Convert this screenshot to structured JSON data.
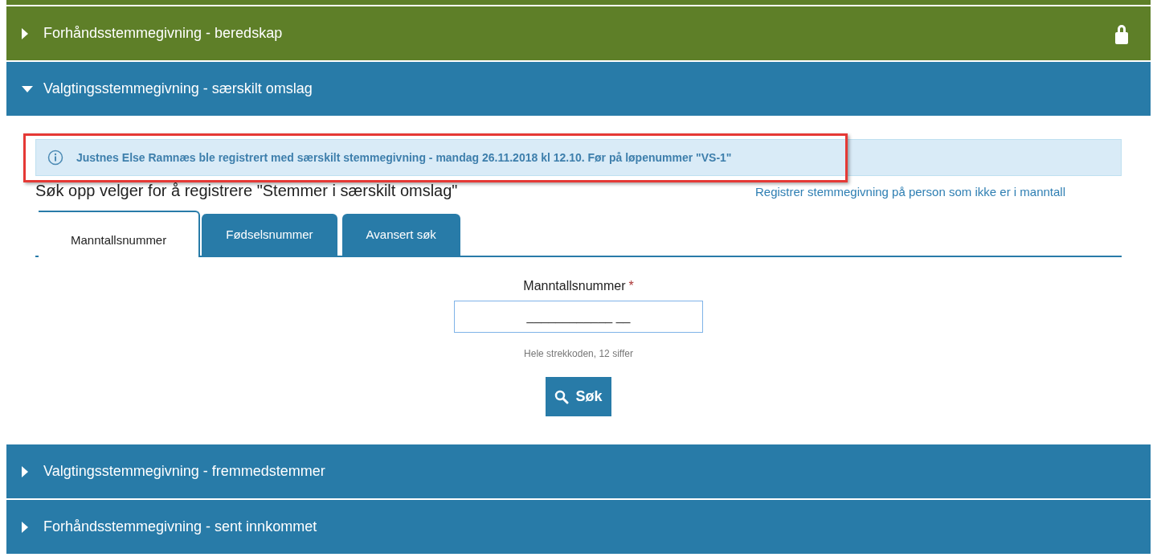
{
  "sections_above": [
    {
      "color": "#5e7f28"
    }
  ],
  "sections": [
    {
      "title": "Forhåndsstemmegivning - beredskap",
      "color": "#5e7f28",
      "expanded": false,
      "locked": true
    },
    {
      "title": "Valgtingsstemmegivning - særskilt omslag",
      "color": "#287ba8",
      "expanded": true,
      "locked": false
    }
  ],
  "panel": {
    "alert": {
      "text": "Justnes Else Ramnæs ble registrert med særskilt stemmegivning - mandag 26.11.2018 kl 12.10. Før på løpenummer \"VS-1\"",
      "highlighted": true
    },
    "heading": "Søk opp velger for å registrere \"Stemmer i særskilt omslag\"",
    "link": "Registrer stemmegivning på person som ikke er i manntall",
    "tabs": [
      {
        "label": "Manntallsnummer",
        "selected": true
      },
      {
        "label": "Fødselsnummer",
        "selected": false
      },
      {
        "label": "Avansert søk",
        "selected": false
      }
    ],
    "field": {
      "label": "Manntallsnummer",
      "required_mark": "*",
      "placeholder": "____________ __",
      "help": "Hele strekkoden, 12 siffer"
    },
    "button": "Søk"
  },
  "sections_below": [
    {
      "title": "Valgtingsstemmegivning - fremmedstemmer",
      "color": "#287ba8",
      "expanded": false,
      "locked": false
    },
    {
      "title": "Forhåndsstemmegivning - sent innkommet",
      "color": "#287ba8",
      "expanded": false,
      "locked": false
    }
  ]
}
